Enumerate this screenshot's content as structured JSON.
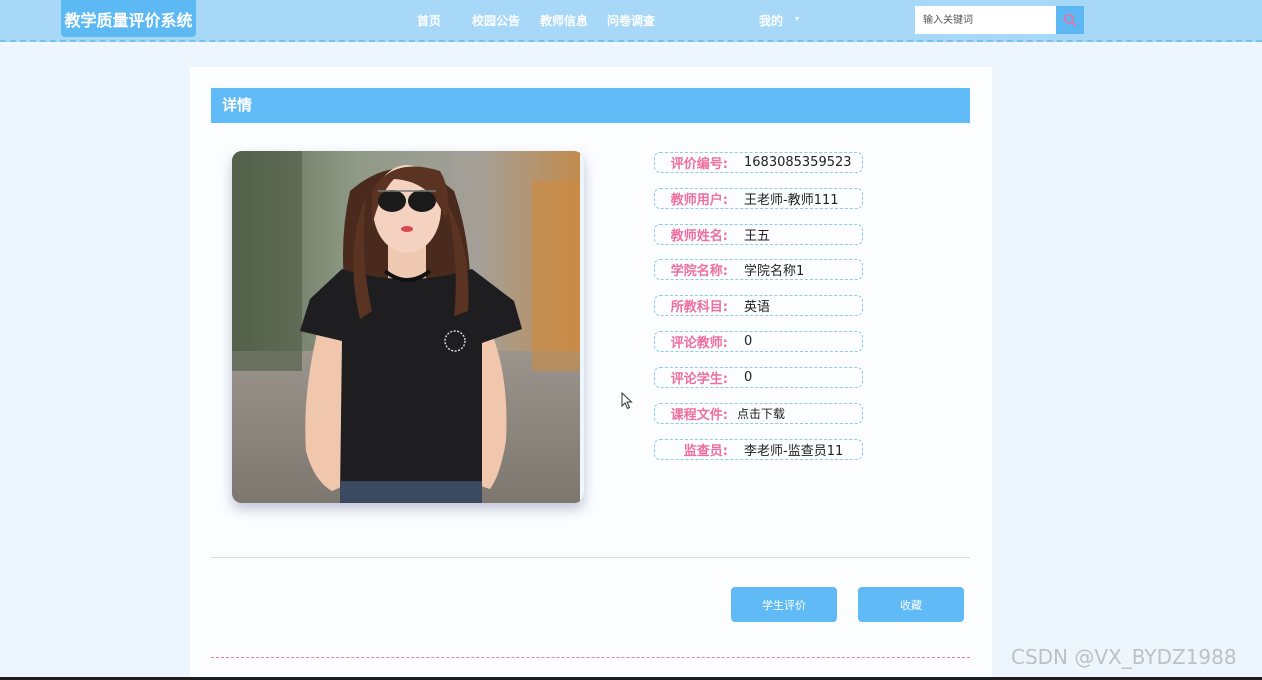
{
  "navbar": {
    "logo": "教学质量评价系统",
    "links": {
      "home": "首页",
      "notice": "校园公告",
      "teacher": "教师信息",
      "survey": "问卷调查",
      "mine": "我的"
    },
    "search_placeholder": "输入关键词"
  },
  "detail": {
    "header": "详情",
    "fields": [
      {
        "label": "评价编号:",
        "value": "1683085359523"
      },
      {
        "label": "教师用户:",
        "value": "王老师-教师111"
      },
      {
        "label": "教师姓名:",
        "value": "王五"
      },
      {
        "label": "学院名称:",
        "value": "学院名称1"
      },
      {
        "label": "所教科目:",
        "value": "英语"
      },
      {
        "label": "评论教师:",
        "value": "0"
      },
      {
        "label": "评论学生:",
        "value": "0"
      },
      {
        "label": "课程文件:",
        "value": "点击下载"
      },
      {
        "label": "监查员:",
        "value": "李老师-监查员11"
      }
    ],
    "buttons": {
      "evaluate": "学生评价",
      "favorite": "收藏"
    }
  },
  "watermark": "CSDN @VX_BYDZ1988",
  "colors": {
    "navbar": "#a7d8f8",
    "accent": "#60bbf6",
    "label": "#ee6fa0"
  }
}
